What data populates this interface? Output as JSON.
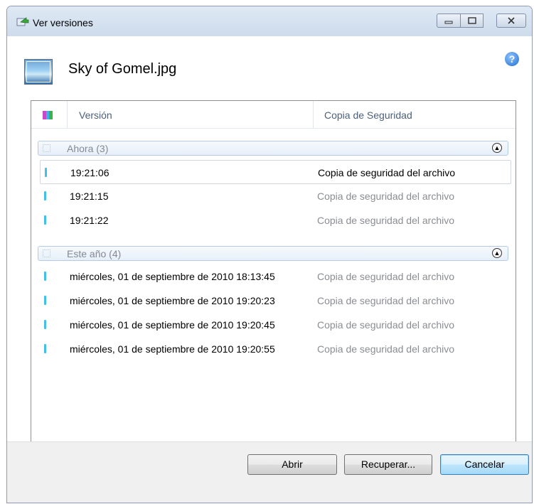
{
  "window": {
    "title": "Ver versiones",
    "file_name": "Sky of Gomel.jpg"
  },
  "columns": {
    "version": "Versión",
    "backup": "Copia de Seguridad"
  },
  "groups": [
    {
      "label": "Ahora (3)",
      "rows": [
        {
          "version": "19:21:06",
          "backup": "Copia de seguridad del archivo"
        },
        {
          "version": "19:21:15",
          "backup": "Copia de seguridad del archivo"
        },
        {
          "version": "19:21:22",
          "backup": "Copia de seguridad del archivo"
        }
      ]
    },
    {
      "label": "Este año (4)",
      "rows": [
        {
          "version": "miércoles, 01 de septiembre de 2010 18:13:45",
          "backup": "Copia de seguridad del archivo"
        },
        {
          "version": "miércoles, 01 de septiembre de 2010 19:20:23",
          "backup": "Copia de seguridad del archivo"
        },
        {
          "version": "miércoles, 01 de septiembre de 2010 19:20:45",
          "backup": "Copia de seguridad del archivo"
        },
        {
          "version": "miércoles, 01 de septiembre de 2010 19:20:55",
          "backup": "Copia de seguridad del archivo"
        }
      ]
    }
  ],
  "buttons": {
    "open": "Abrir",
    "recover": "Recuperar...",
    "cancel": "Cancelar"
  },
  "icons": {
    "title": "restore-arrow-icon",
    "file": "image-file-icon",
    "help": "help-icon",
    "column": "column-picker-icon"
  },
  "colors": {
    "accent": "#43bfe8",
    "group_border": "#b3cbe6"
  }
}
